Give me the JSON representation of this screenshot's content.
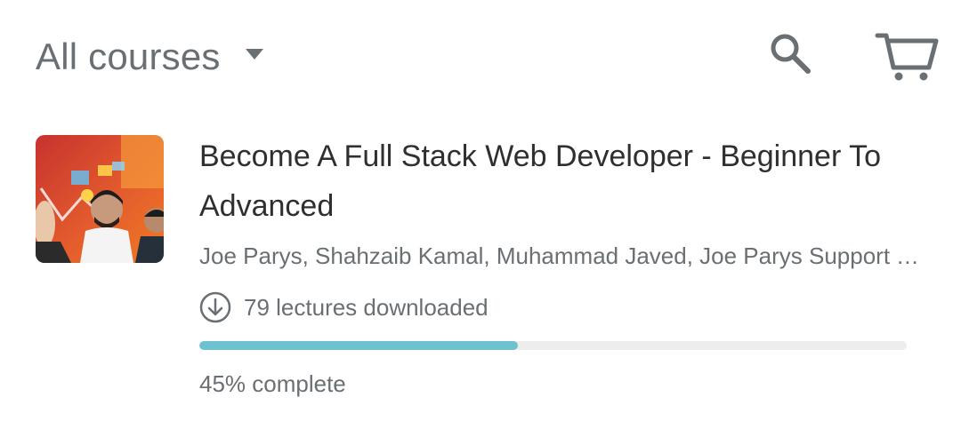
{
  "header": {
    "filter_label": "All courses",
    "search_icon": "search-icon",
    "cart_icon": "cart-icon"
  },
  "course": {
    "title": "Become A Full Stack Web Developer - Beginner To Advanced",
    "authors": "Joe Parys, Shahzaib Kamal, Muhammad Javed, Joe Parys Support Team",
    "downloads_icon": "download-circle-icon",
    "downloads_text": "79 lectures downloaded",
    "progress_percent": 45,
    "progress_text": "45% complete"
  },
  "colors": {
    "text_primary": "#2d2f31",
    "text_secondary": "#6a6f73",
    "progress_fill": "#6ec2d0",
    "progress_track": "#ededed"
  }
}
